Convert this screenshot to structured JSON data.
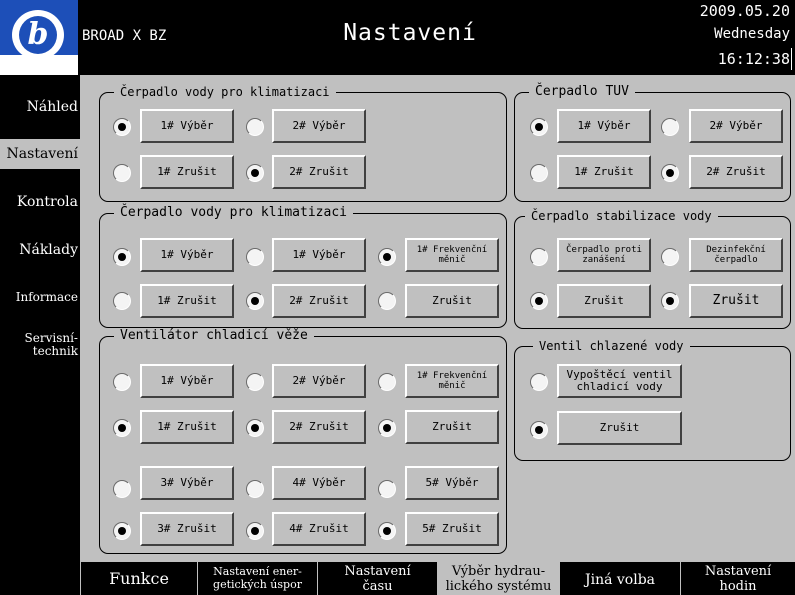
{
  "header": {
    "brand": "BROAD X BZ",
    "title": "Nastavení",
    "date": "2009.05.20",
    "weekday": "Wednesday",
    "time": "16:12:38",
    "logo_glyph": "b"
  },
  "sidebar": {
    "items": [
      {
        "label": "Náhled"
      },
      {
        "label": "Nastavení",
        "active": true
      },
      {
        "label": "Kontrola"
      },
      {
        "label": "Náklady"
      },
      {
        "label": "Informace"
      },
      {
        "label_lines": [
          "Servisní-",
          "technik"
        ]
      }
    ]
  },
  "groups": {
    "g1": {
      "title": "Čerpadlo vody pro klimatizaci",
      "buttons": [
        "1# Výběr",
        "2# Výběr",
        "1# Zrušit",
        "2# Zrušit"
      ],
      "radios_on": [
        true,
        false,
        false,
        true
      ]
    },
    "g2": {
      "title": "Čerpadlo TUV",
      "buttons": [
        "1# Výběr",
        "2# Výběr",
        "1# Zrušit",
        "2# Zrušit"
      ],
      "radios_on": [
        true,
        false,
        false,
        true
      ]
    },
    "g3": {
      "title": "Čerpadlo vody pro klimatizaci",
      "buttons": [
        "1# Výběr",
        "1# Výběr",
        "1# Frekvenční měnič",
        "1# Zrušit",
        "2# Zrušit",
        "Zrušit"
      ],
      "radios_on": [
        true,
        false,
        true,
        false,
        true,
        false
      ]
    },
    "g4": {
      "title": "Čerpadlo stabilizace vody",
      "buttons": [
        "Čerpadlo proti zanášení",
        "Dezinfekční čerpadlo",
        "Zrušit",
        "Zrušit"
      ],
      "radios_on": [
        false,
        false,
        true,
        true
      ]
    },
    "g5": {
      "title": "Ventilátor chladicí věže",
      "buttons": [
        "1# Výběr",
        "2# Výběr",
        "1# Frekvenční měnič",
        "1# Zrušit",
        "2# Zrušit",
        "Zrušit",
        "3# Výběr",
        "4# Výběr",
        "5# Výběr",
        "3# Zrušit",
        "4# Zrušit",
        "5# Zrušit"
      ],
      "radios_on": [
        false,
        false,
        false,
        true,
        true,
        true,
        false,
        false,
        false,
        true,
        true,
        true
      ]
    },
    "g6": {
      "title": "Ventil chlazené vody",
      "buttons": [
        "Vypoštěcí ventil chladicí vody",
        "Zrušit"
      ],
      "radios_on": [
        false,
        true
      ]
    }
  },
  "footer": {
    "tabs": [
      {
        "lines": [
          "Funkce"
        ]
      },
      {
        "lines": [
          "Nastavení ener-",
          "getických úspor"
        ]
      },
      {
        "lines": [
          "Nastavení",
          "času"
        ]
      },
      {
        "lines": [
          "Výběr hydrau-",
          "lického systému"
        ],
        "active": true
      },
      {
        "lines": [
          "Jiná volba"
        ]
      },
      {
        "lines": [
          "Nastavení",
          "hodin"
        ]
      }
    ]
  },
  "colors": {
    "panel": "#c0c0c0",
    "logo_blue": "#1d4fb8",
    "background": "#000000"
  }
}
